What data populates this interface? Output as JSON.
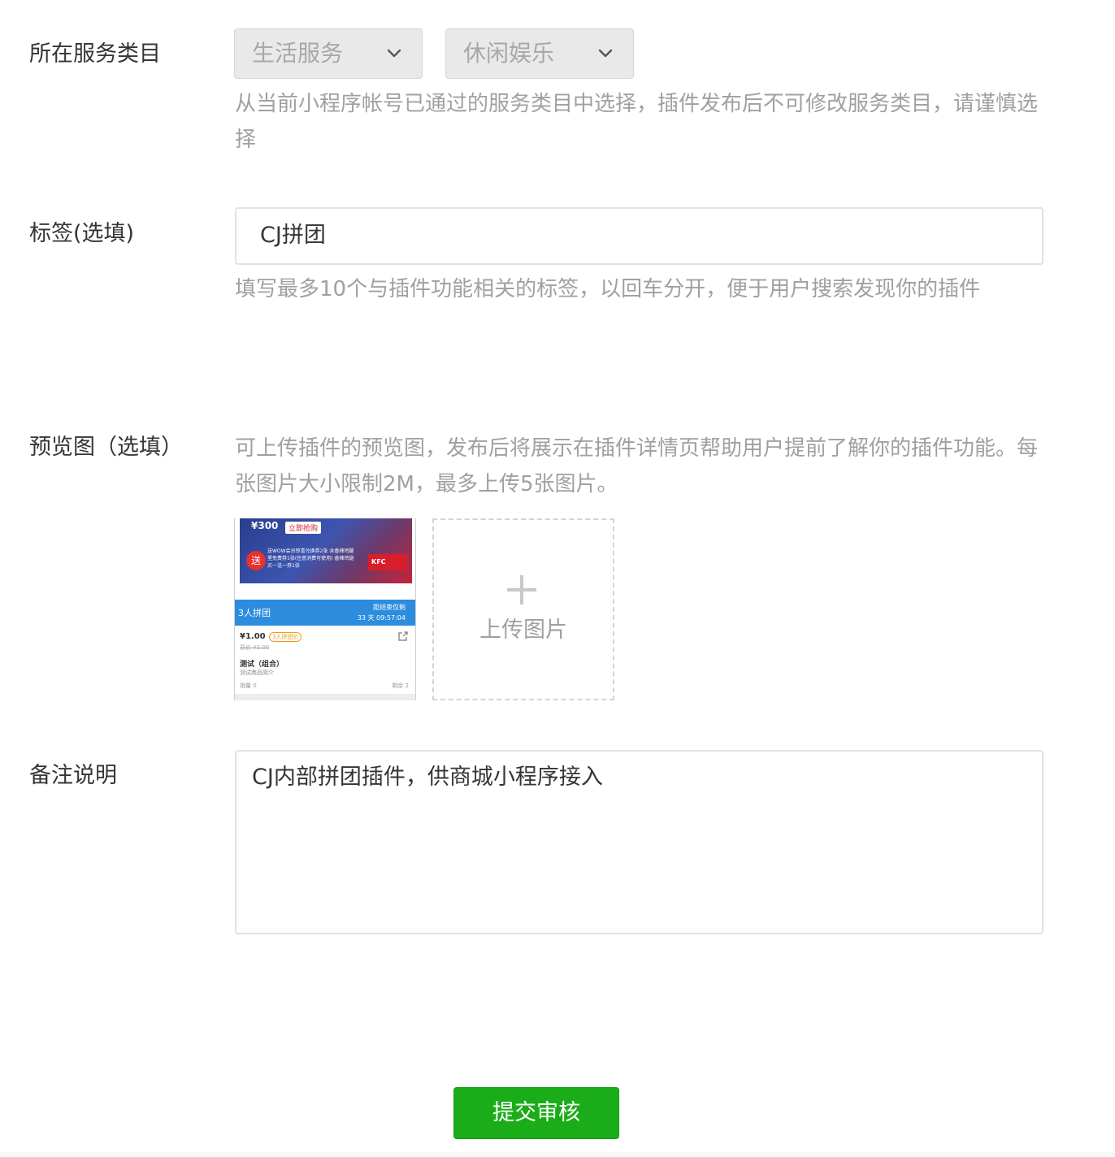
{
  "service_category": {
    "label": "所在服务类目",
    "primary_select": "生活服务",
    "secondary_select": "休闲娱乐",
    "hint": "从当前小程序帐号已通过的服务类目中选择，插件发布后不可修改服务类目，请谨慎选择"
  },
  "tags": {
    "label": "标签(选填)",
    "value": "CJ拼团",
    "hint": "填写最多10个与插件功能相关的标签，以回车分开，便于用户搜索发现你的插件"
  },
  "preview": {
    "label": "预览图（选填）",
    "hint": "可上传插件的预览图，发布后将展示在插件详情页帮助用户提前了解你的插件功能。每张图片大小限制2M，最多上传5张图片。",
    "upload_label": "上传图片",
    "thumbnail": {
      "banner_price": "¥300",
      "banner_button": "立即抢购",
      "gift_mark": "送",
      "gift_text": "送WOW会员惊喜兑换券2张 含香辣鸡腿堡免费券1张(任意消费可使用) 香辣鸡翅买一送一券1张",
      "brand": "KFC",
      "group_title": "3人拼团",
      "countdown_label": "距结束仅剩",
      "countdown_value": "33 天 09:57:04",
      "price": "¥1.00",
      "price_tag": "3人拼团价",
      "original_price": "原价 ¥2.00",
      "product_name": "测试（组合）",
      "product_desc": "测试商品简介",
      "sold": "销量 0",
      "remaining": "剩余 2"
    }
  },
  "remarks": {
    "label": "备注说明",
    "value": "CJ内部拼团插件，供商城小程序接入"
  },
  "submit": {
    "label": "提交审核"
  },
  "colors": {
    "primary_green": "#1aad19",
    "hint_gray": "#a0a0a0",
    "text_dark": "#353535"
  },
  "icons": {
    "select_arrow": "chevron-down-icon",
    "upload": "plus-icon",
    "share": "share-icon"
  }
}
